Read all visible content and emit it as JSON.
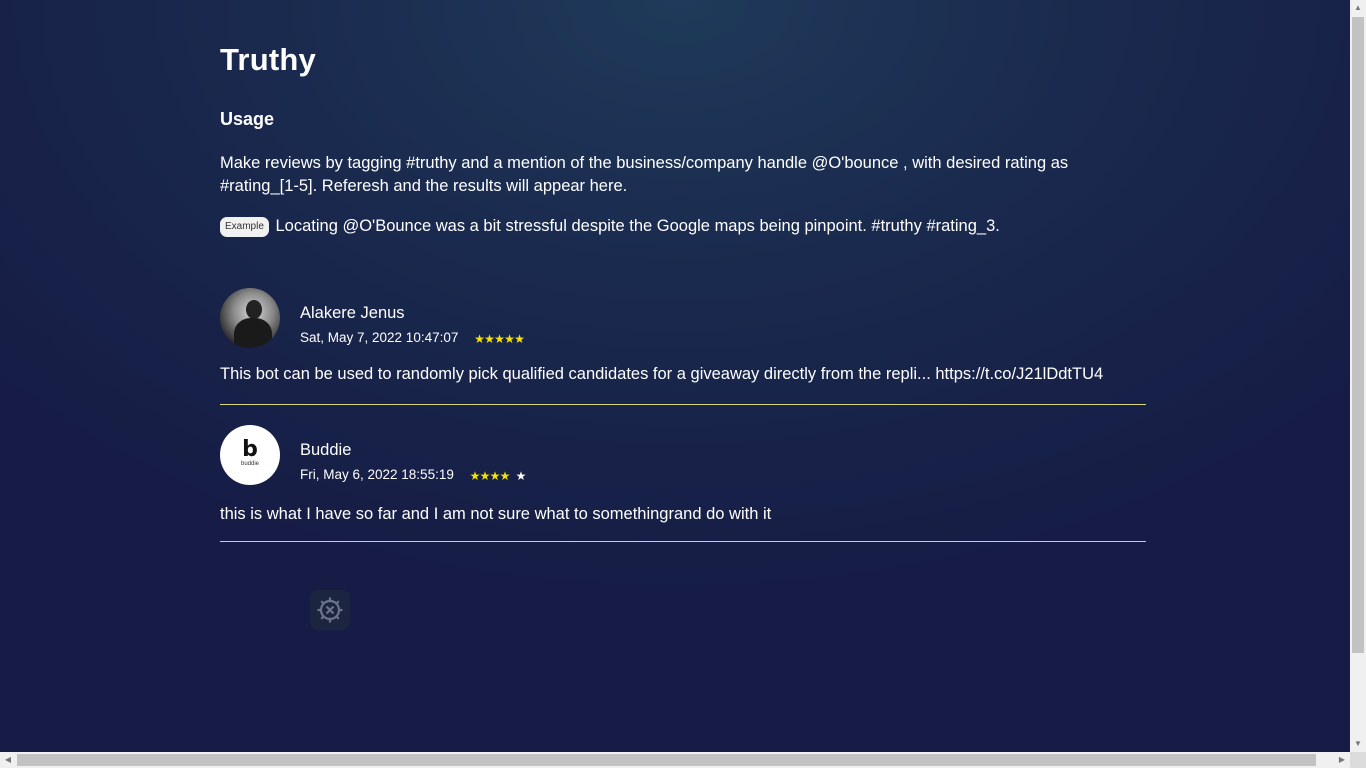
{
  "app": {
    "title": "Truthy",
    "subtitle": "Usage",
    "usage_text": "Make reviews by tagging #truthy and a mention of the business/company handle @O'bounce , with desired rating as #rating_[1-5]. Referesh and the results will appear here.",
    "example_badge": "Example",
    "example_text": "Locating @O'Bounce was a bit stressful despite the Google maps being pinpoint. #truthy #rating_3."
  },
  "reviews": [
    {
      "name": "Alakere Jenus",
      "date": "Sat, May 7, 2022 10:47:07",
      "rating": 5,
      "max_rating": 5,
      "text": "This bot can be used to randomly pick qualified candidates for a giveaway directly from the repli... https://t.co/J21lDdtTU4",
      "avatar": "profile-photo"
    },
    {
      "name": "Buddie",
      "date": "Fri, May 6, 2022 18:55:19",
      "rating": 4,
      "max_rating": 5,
      "text": "this is what I have so far and I am not sure what to somethingrand do with it",
      "avatar": "buddie-logo",
      "avatar_logo_letter": "b",
      "avatar_logo_text": "buddie"
    }
  ],
  "colors": {
    "star_on": "#f5e300",
    "star_off": "#ffffff",
    "divider": "#d8d67a",
    "background": "#1a2a4e"
  },
  "icons": {
    "settings": "gear-icon"
  }
}
